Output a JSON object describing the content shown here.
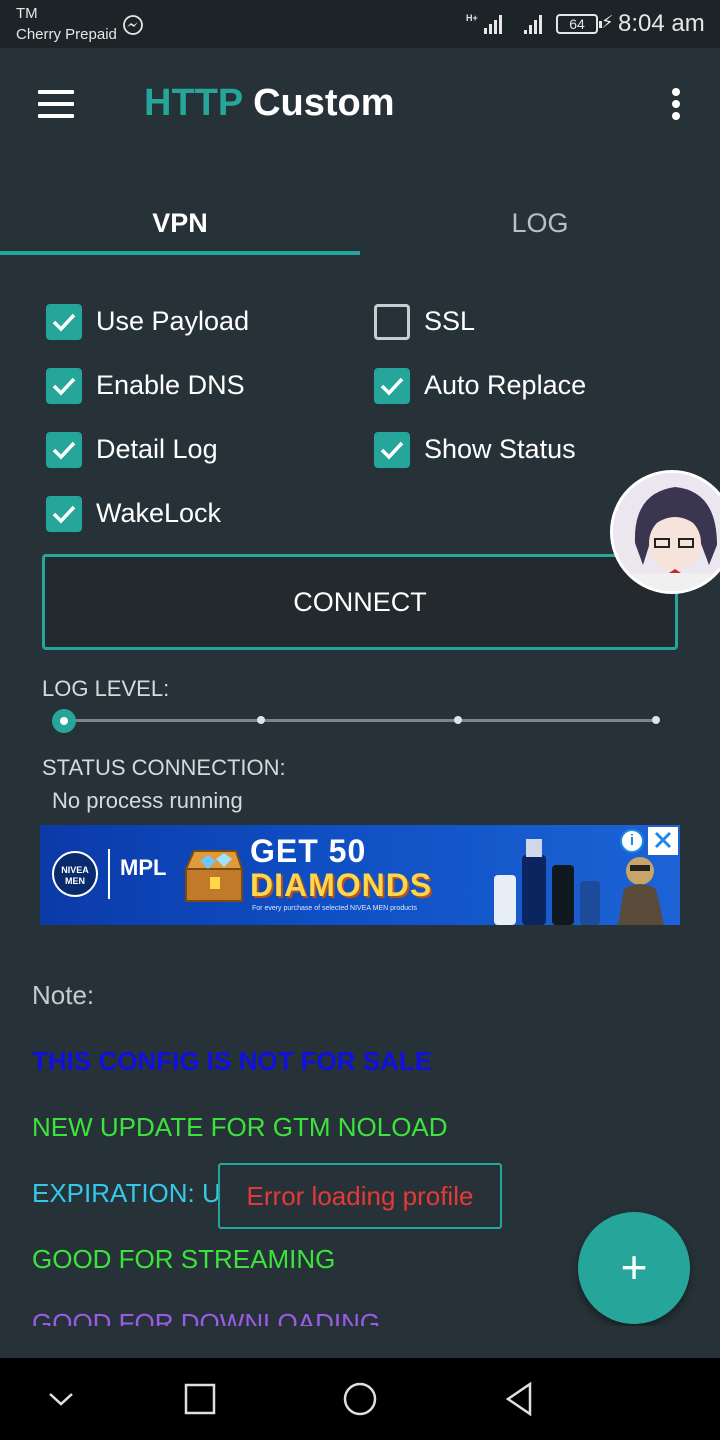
{
  "status_bar": {
    "tm": "TM",
    "carrier": "Cherry Prepaid",
    "battery": "64",
    "time": "8:04 am"
  },
  "app": {
    "title_accent": "HTTP",
    "title_rest": " Custom"
  },
  "tabs": [
    {
      "label": "VPN",
      "active": true
    },
    {
      "label": "LOG",
      "active": false
    }
  ],
  "options": {
    "use_payload": {
      "label": "Use Payload",
      "checked": true
    },
    "ssl": {
      "label": "SSL",
      "checked": false
    },
    "enable_dns": {
      "label": "Enable DNS",
      "checked": true
    },
    "auto_replace": {
      "label": "Auto Replace",
      "checked": true
    },
    "detail_log": {
      "label": "Detail Log",
      "checked": true
    },
    "show_status": {
      "label": "Show Status",
      "checked": true
    },
    "wakelock": {
      "label": "WakeLock",
      "checked": true
    }
  },
  "connect_label": "CONNECT",
  "log_level": {
    "label": "LOG LEVEL:",
    "value": 0,
    "steps": 4
  },
  "status": {
    "label": "STATUS CONNECTION:",
    "value": "No process running"
  },
  "ad": {
    "brand": "NIVEA MEN",
    "game": "MPL",
    "headline": "GET 50",
    "headline2": "DIAMONDS",
    "fine_print": "For every purchase of selected NIVEA MEN products"
  },
  "note": {
    "title": "Note:",
    "lines": [
      "THIS CONFIG IS NOT FOR SALE",
      "NEW UPDATE FOR GTM NOLOAD",
      "EXPIRATION: U",
      "GOOD FOR STREAMING",
      "GOOD FOR DOWNLOADING"
    ]
  },
  "toast": "Error loading profile",
  "colors": {
    "accent": "#26a69a",
    "background": "#263238",
    "error": "#e53935"
  }
}
